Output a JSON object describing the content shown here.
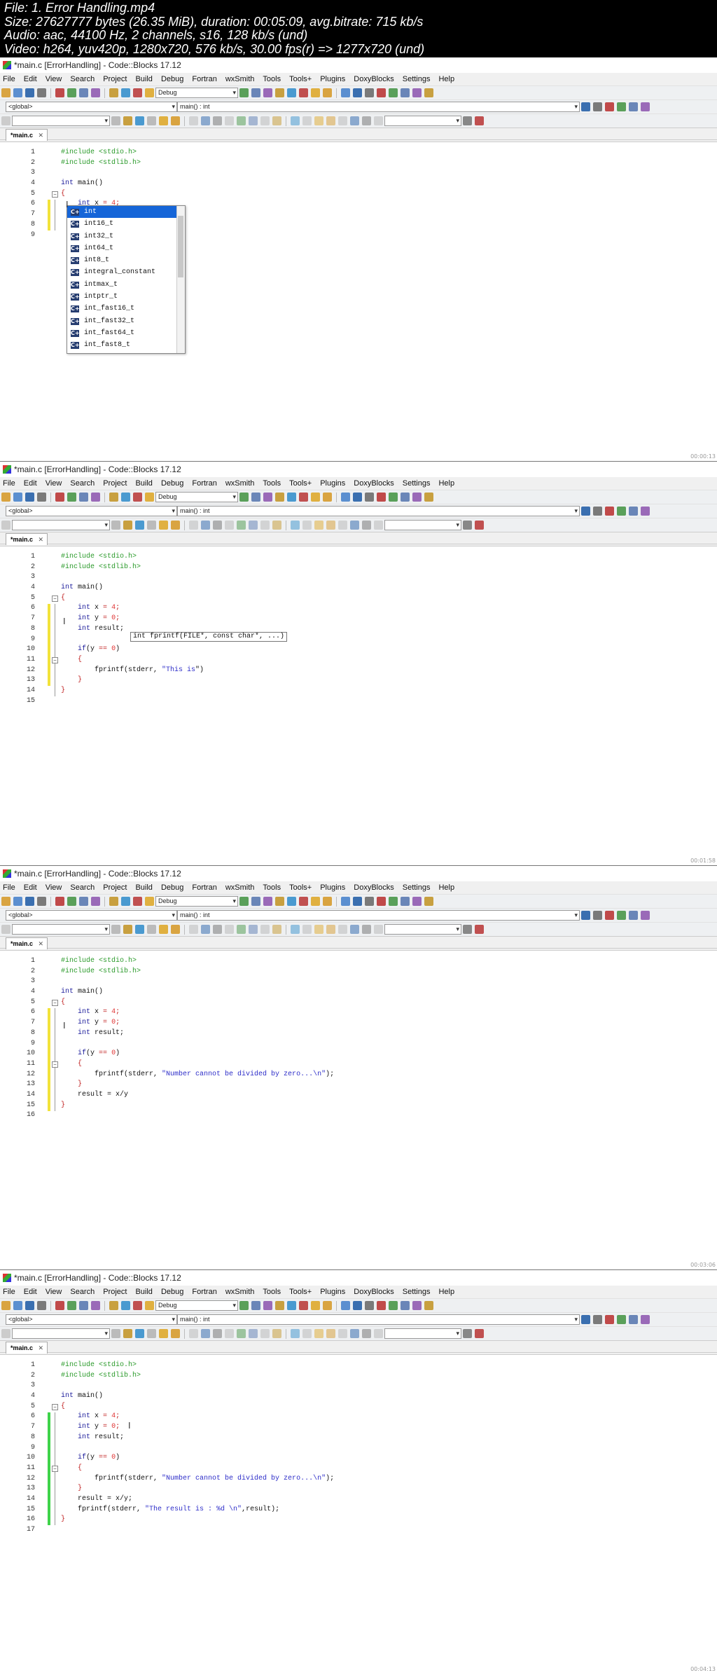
{
  "info": {
    "lines": [
      "File: 1. Error Handling.mp4",
      "Size: 27627777 bytes (26.35 MiB), duration: 00:05:09, avg.bitrate: 715 kb/s",
      "Audio: aac, 44100 Hz, 2 channels, s16, 128 kb/s (und)",
      "Video: h264, yuv420p, 1280x720, 576 kb/s, 30.00 fps(r) => 1277x720 (und)"
    ]
  },
  "menu": [
    "File",
    "Edit",
    "View",
    "Search",
    "Project",
    "Build",
    "Debug",
    "Fortran",
    "wxSmith",
    "Tools",
    "Tools+",
    "Plugins",
    "DoxyBlocks",
    "Settings",
    "Help"
  ],
  "build_target": "Debug",
  "scope": "<global>",
  "tab_label": "*main.c",
  "tab_close": "✕",
  "frames": [
    {
      "title": "*main.c [ErrorHandling] - Code::Blocks 17.12",
      "symbol": "main() : int",
      "timestamp": "00:00:13",
      "line_count": 9,
      "autocomplete": {
        "items": [
          "int",
          "int16_t",
          "int32_t",
          "int64_t",
          "int8_t",
          "integral_constant",
          "intmax_t",
          "intptr_t",
          "int_fast16_t",
          "int_fast32_t",
          "int_fast64_t",
          "int_fast8_t"
        ],
        "selected": 0
      }
    },
    {
      "title": "*main.c [ErrorHandling] - Code::Blocks 17.12",
      "symbol": "main() : int",
      "timestamp": "00:01:58",
      "line_count": 15,
      "calltip": "int fprintf(FILE*, const char*, ...)"
    },
    {
      "title": "*main.c [ErrorHandling] - Code::Blocks 17.12",
      "symbol": "main() : int",
      "timestamp": "00:03:06",
      "line_count": 16
    },
    {
      "title": "*main.c [ErrorHandling] - Code::Blocks 17.12",
      "symbol": "main() : int",
      "timestamp": "00:04:13",
      "line_count": 17
    }
  ]
}
